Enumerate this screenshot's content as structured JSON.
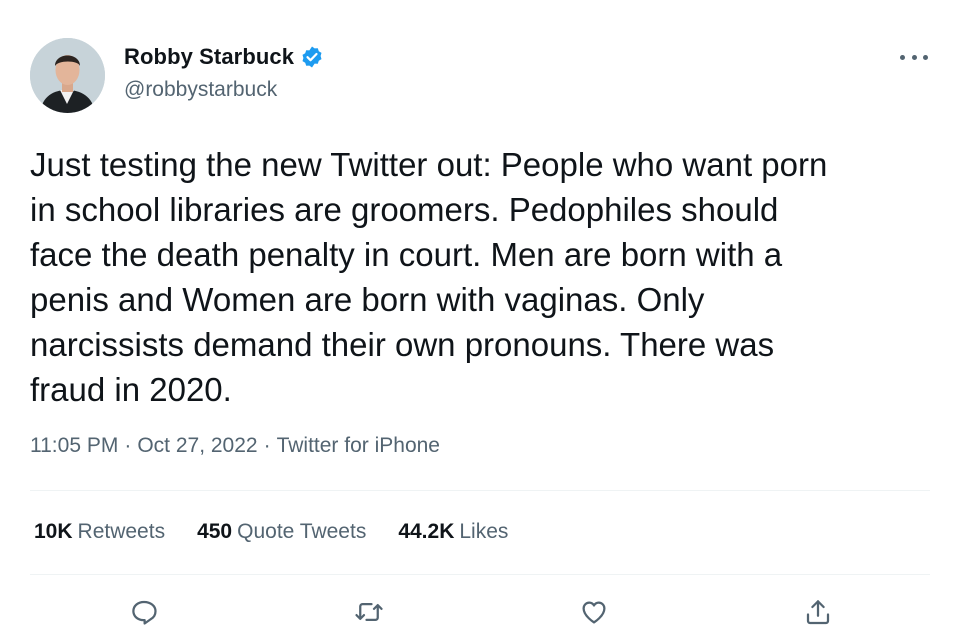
{
  "user": {
    "name": "Robby Starbuck",
    "handle": "@robbystarbuck",
    "verified": true,
    "verified_color": "#1d9bf0"
  },
  "tweet": {
    "text": "Just testing the new Twitter out: People who want porn\nin school libraries are groomers. Pedophiles should\nface the death penalty in court. Men are born with a\npenis and Women are born with vaginas. Only\nnarcissists demand their own pronouns. There was\nfraud in 2020.",
    "time": "11:05 PM",
    "date": "Oct 27, 2022",
    "source": "Twitter for iPhone",
    "separator": "·"
  },
  "stats": {
    "retweets_count": "10K",
    "retweets_label": "Retweets",
    "quotes_count": "450",
    "quotes_label": "Quote Tweets",
    "likes_count": "44.2K",
    "likes_label": "Likes"
  },
  "icons": {
    "more": "more-horizontal-icon",
    "reply": "reply-icon",
    "retweet": "retweet-icon",
    "like": "heart-icon",
    "share": "share-icon"
  },
  "colors": {
    "text_primary": "#0f1419",
    "text_secondary": "#536471",
    "divider": "#eff3f4"
  }
}
